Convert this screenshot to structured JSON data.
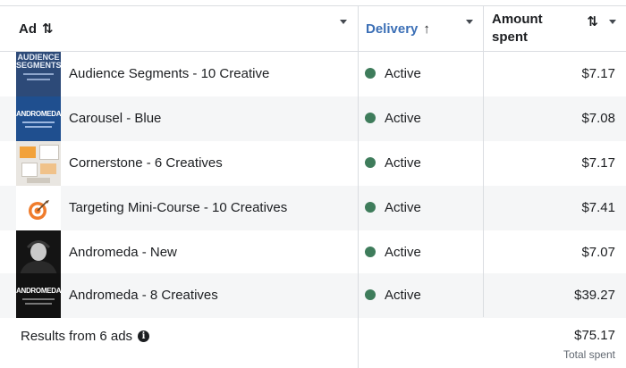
{
  "header": {
    "ad_label": "Ad",
    "ad_sort": "⇅",
    "delivery_label": "Delivery",
    "delivery_sort": "↑",
    "amount_label_1": "Amount",
    "amount_label_2": "spent",
    "amount_sort": "⇅"
  },
  "rows": [
    {
      "name": "Audience Segments - 10 Creative",
      "status": "Active",
      "amount": "$7.17",
      "thumb": "audience-segments-thumbnail"
    },
    {
      "name": "Carousel - Blue",
      "status": "Active",
      "amount": "$7.08",
      "thumb": "andromeda-blue-thumbnail"
    },
    {
      "name": "Cornerstone - 6 Creatives",
      "status": "Active",
      "amount": "$7.17",
      "thumb": "cornerstone-thumbnail"
    },
    {
      "name": "Targeting Mini-Course - 10 Creatives",
      "status": "Active",
      "amount": "$7.41",
      "thumb": "target-icon-thumbnail"
    },
    {
      "name": "Andromeda - New",
      "status": "Active",
      "amount": "$7.07",
      "thumb": "person-photo-thumbnail"
    },
    {
      "name": "Andromeda - 8 Creatives",
      "status": "Active",
      "amount": "$39.27",
      "thumb": "andromeda-black-thumbnail"
    }
  ],
  "thumb_text": {
    "audience_1": "AUDIENCE",
    "audience_2": "SEGMENTS",
    "andromeda": "ANDROMEDA"
  },
  "footer": {
    "results_label": "Results from 6 ads",
    "info_glyph": "i",
    "total": "$75.17",
    "total_label": "Total spent"
  },
  "colors": {
    "active_dot": "#3e7c5b",
    "delivery_header": "#3b6fb6",
    "row_alt": "#f5f6f7",
    "border": "#dadde1"
  }
}
